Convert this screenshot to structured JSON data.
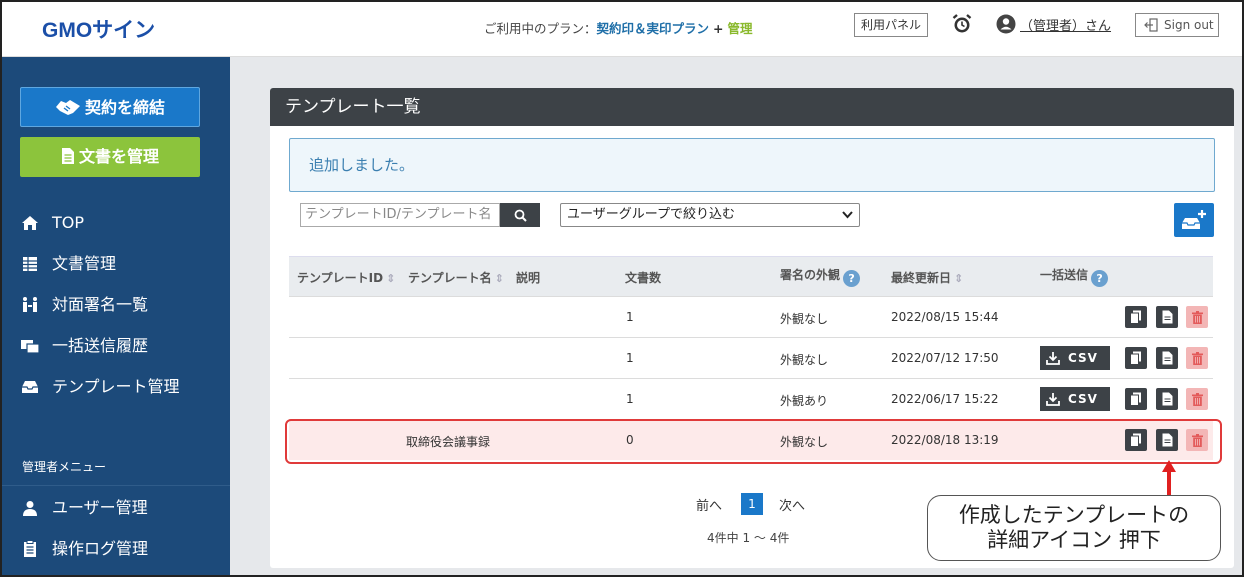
{
  "header": {
    "logo": "GMOサイン",
    "plan_prefix": "ご利用中のプラン：",
    "plan_main": "契約印＆実印プラン",
    "plan_plus": "+",
    "plan_extra": "管理",
    "panel_button": "利用パネル",
    "user_name": "（管理者）さん",
    "signout": "Sign out"
  },
  "sidebar": {
    "primary_button": "契約を締結",
    "secondary_button": "文書を管理",
    "items": [
      {
        "label": "TOP",
        "icon": "home-icon"
      },
      {
        "label": "文書管理",
        "icon": "table-icon"
      },
      {
        "label": "対面署名一覧",
        "icon": "people-icon"
      },
      {
        "label": "一括送信履歴",
        "icon": "bulk-send-icon"
      },
      {
        "label": "テンプレート管理",
        "icon": "inbox-icon"
      }
    ],
    "admin_label": "管理者メニュー",
    "admin_items": [
      {
        "label": "ユーザー管理",
        "icon": "user-icon"
      },
      {
        "label": "操作ログ管理",
        "icon": "log-icon"
      }
    ]
  },
  "panel": {
    "title": "テンプレート一覧",
    "alert": "追加しました。",
    "search_placeholder": "テンプレートID/テンプレート名",
    "group_select": "ユーザーグループで絞り込む"
  },
  "table": {
    "headers": {
      "template_id": "テンプレートID",
      "template_name": "テンプレート名",
      "description": "説明",
      "doc_count": "文書数",
      "signature": "署名の外観",
      "updated": "最終更新日",
      "bulk": "一括送信"
    },
    "csv_label": "CSV",
    "rows": [
      {
        "name": "",
        "count": "1",
        "appearance": "外観なし",
        "updated": "2022/08/15 15:44",
        "csv": false
      },
      {
        "name": "",
        "count": "1",
        "appearance": "外観なし",
        "updated": "2022/07/12 17:50",
        "csv": true
      },
      {
        "name": "",
        "count": "1",
        "appearance": "外観あり",
        "updated": "2022/06/17 15:22",
        "csv": true
      },
      {
        "name": "取締役会議事録",
        "count": "0",
        "appearance": "外観なし",
        "updated": "2022/08/18 13:19",
        "csv": false
      }
    ]
  },
  "pagination": {
    "prev": "前へ",
    "current": "1",
    "next": "次へ",
    "summary": "4件中 1 〜 4件"
  },
  "annotation": {
    "line1": "作成したテンプレートの",
    "line2": "詳細アイコン 押下"
  },
  "colors": {
    "sidebar": "#1c4a7a",
    "primary": "#1a78c9",
    "secondary": "#8cc43c",
    "highlight": "#e03a3a"
  }
}
